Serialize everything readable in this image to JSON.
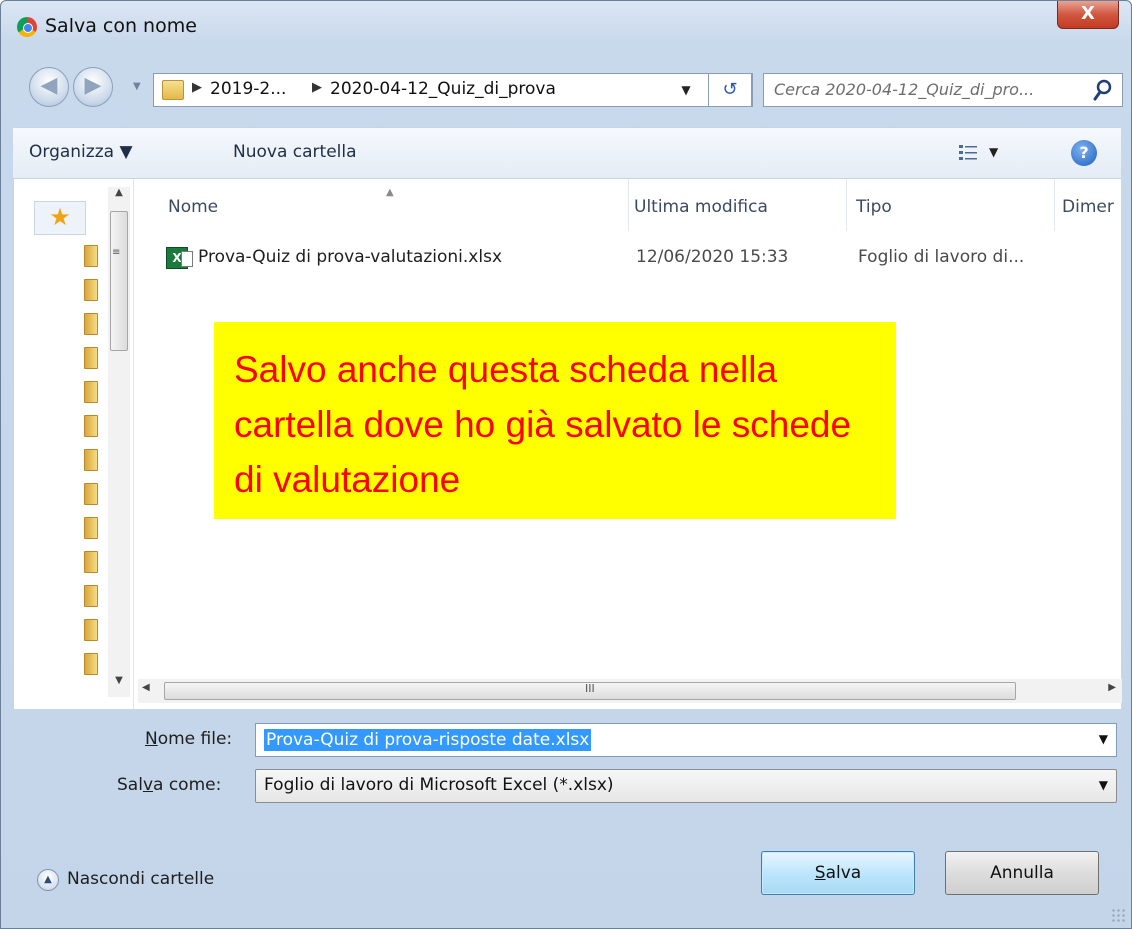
{
  "window": {
    "title": "Salva con nome",
    "close_label": "X"
  },
  "address": {
    "crumbs": [
      "2019-2...",
      "2020-04-12_Quiz_di_prova"
    ],
    "search_placeholder": "Cerca 2020-04-12_Quiz_di_pro..."
  },
  "toolbar": {
    "organize_label": "Organizza ▼",
    "new_folder_label": "Nuova cartella",
    "help_label": "?"
  },
  "columns": [
    "Nome",
    "Ultima modifica",
    "Tipo",
    "Dimer"
  ],
  "files": [
    {
      "name": "Prova-Quiz di prova-valutazioni.xlsx",
      "modified": "12/06/2020 15:33",
      "type": "Foglio di lavoro di..."
    }
  ],
  "scrollbar": {
    "grip": "III"
  },
  "annotation": {
    "text": "Salvo anche questa scheda nella cartella dove ho già salvato le schede di valutazione",
    "bg_color": "#ffff00",
    "text_color": "#ff0000"
  },
  "form": {
    "filename_label_u": "N",
    "filename_label_rest": "ome file:",
    "filename_value": "Prova-Quiz di prova-risposte date.xlsx",
    "type_label_a": "Sal",
    "type_label_u": "v",
    "type_label_b": "a come:",
    "type_value": "Foglio di lavoro di Microsoft Excel (*.xlsx)"
  },
  "footer": {
    "hide_folders_label": "Nascondi cartelle",
    "save_u": "S",
    "save_rest": "alva",
    "cancel_label": "Annulla"
  }
}
